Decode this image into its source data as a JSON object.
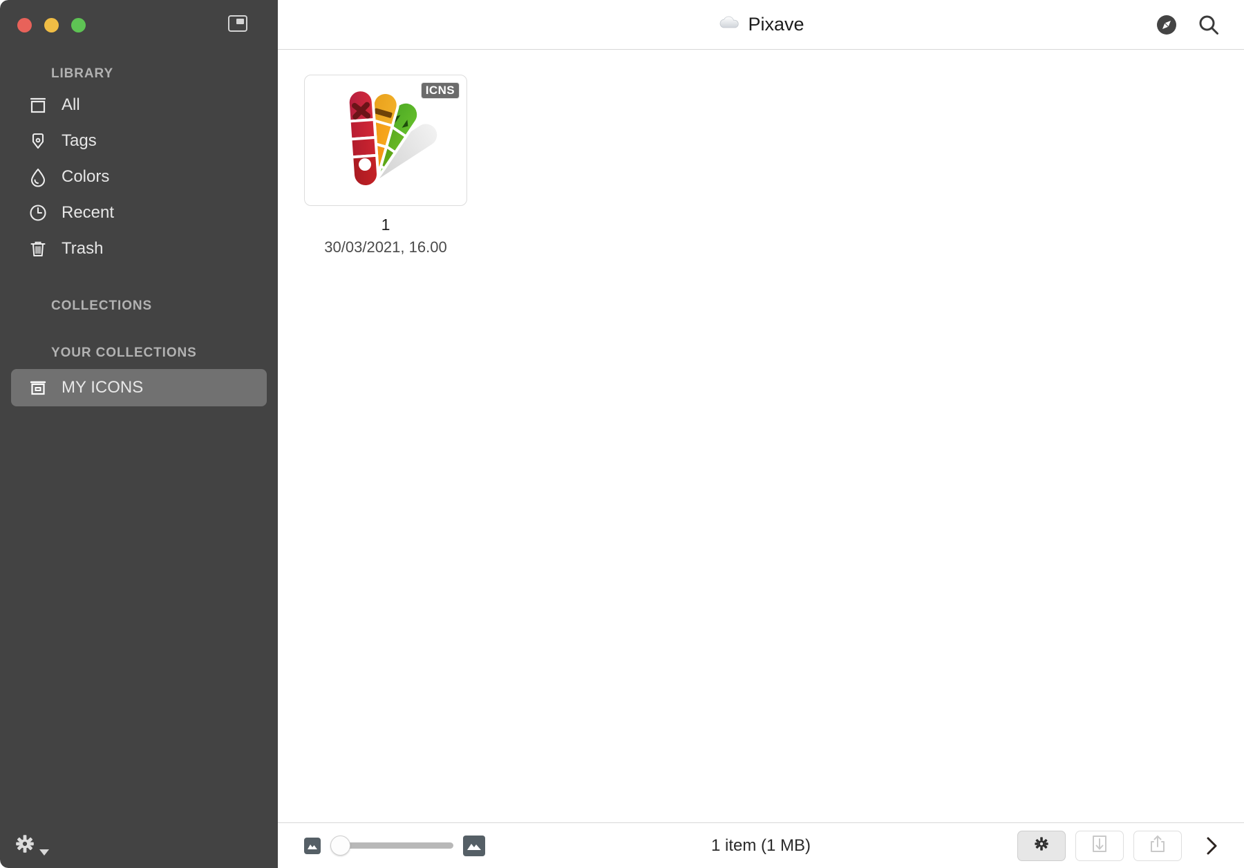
{
  "window": {
    "traffic_lights": {
      "close_color": "#e8625a",
      "minimize_color": "#f0bd45",
      "zoom_color": "#5ec354"
    },
    "sidebar_toggle_name": "sidebar-toggle"
  },
  "toolbar": {
    "title": "Pixave",
    "title_icon": "cloud-icon",
    "actions": [
      {
        "name": "browse-compass-icon",
        "label": "Browse"
      },
      {
        "name": "search-icon",
        "label": "Search"
      }
    ]
  },
  "sidebar": {
    "sections": [
      {
        "header": "LIBRARY"
      },
      {
        "header": "COLLECTIONS"
      },
      {
        "header": "YOUR COLLECTIONS"
      }
    ],
    "library_header": "LIBRARY",
    "collections_header": "COLLECTIONS",
    "your_collections_header": "YOUR COLLECTIONS",
    "library_items": [
      {
        "label": "All",
        "icon": "archive-box-icon",
        "selected": false
      },
      {
        "label": "Tags",
        "icon": "tag-icon",
        "selected": false
      },
      {
        "label": "Colors",
        "icon": "droplet-icon",
        "selected": false
      },
      {
        "label": "Recent",
        "icon": "clock-icon",
        "selected": false
      },
      {
        "label": "Trash",
        "icon": "trash-icon",
        "selected": false
      }
    ],
    "collection_items": [
      {
        "label": "MY ICONS",
        "icon": "archive-box-icon",
        "selected": true
      }
    ],
    "footer": {
      "settings_label": "Settings",
      "icon": "gear-icon",
      "has_dropdown_caret": true
    },
    "background_color": "#434343",
    "selected_color": "#717171"
  },
  "content": {
    "items": [
      {
        "name": "1",
        "date": "30/03/2021, 16.00",
        "badge": "ICNS",
        "thumbnail_icon": "color-swatch-fan-icon"
      }
    ]
  },
  "bottombar": {
    "zoom_small_icon": "small-image-icon",
    "zoom_large_icon": "large-image-icon",
    "zoom_slider_value": 0,
    "status": "1 item (1 MB)",
    "buttons": [
      {
        "name": "info-gear-button",
        "icon": "gear-icon",
        "state": "active"
      },
      {
        "name": "download-button",
        "icon": "download-icon",
        "state": "disabled"
      },
      {
        "name": "share-button",
        "icon": "share-icon",
        "state": "disabled"
      }
    ],
    "inspector_toggle": "chevron-right-icon"
  }
}
